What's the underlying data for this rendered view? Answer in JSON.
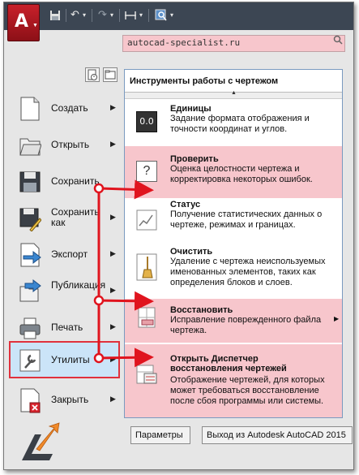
{
  "search": {
    "value": "autocad-specialist.ru"
  },
  "menu": {
    "items": [
      {
        "label": "Создать",
        "has_arrow": true
      },
      {
        "label": "Открыть",
        "has_arrow": true
      },
      {
        "label": "Сохранить",
        "has_arrow": false
      },
      {
        "label": "Сохранить как",
        "has_arrow": true
      },
      {
        "label": "Экспорт",
        "has_arrow": true
      },
      {
        "label": "Публикация",
        "has_arrow": true
      },
      {
        "label": "Печать",
        "has_arrow": true
      },
      {
        "label": "Утилиты",
        "has_arrow": true,
        "selected": true
      },
      {
        "label": "Закрыть",
        "has_arrow": true
      }
    ]
  },
  "panel": {
    "title": "Инструменты работы с чертежом",
    "items": [
      {
        "title": "Единицы",
        "desc": "Задание формата отображения и точности координат и углов.",
        "highlighted": false,
        "icon": "units-icon",
        "icon_text": "0.0"
      },
      {
        "title": "Проверить",
        "desc": "Оценка целостности чертежа и корректировка некоторых ошибок.",
        "highlighted": true,
        "icon": "audit-icon",
        "icon_text": "?"
      },
      {
        "title": "Статус",
        "desc": "Получение статистических данных о чертеже, режимах и границах.",
        "highlighted": false,
        "icon": "status-icon"
      },
      {
        "title": "Очистить",
        "desc": "Удаление с чертежа неиспользуемых именованных элементов, таких как определения блоков и слоев.",
        "highlighted": false,
        "icon": "purge-broom-icon"
      },
      {
        "title": "Восстановить",
        "desc": "Исправление поврежденного файла чертежа.",
        "highlighted": true,
        "icon": "recover-icon",
        "has_arrow": true
      },
      {
        "title": "Открыть Диспетчер восстановления чертежей",
        "desc": "Отображение чертежей, для которых может требоваться восстановление после сбоя программы или системы.",
        "highlighted": true,
        "icon": "drawing-recovery-icon"
      }
    ]
  },
  "buttons": {
    "options": "Параметры",
    "exit": "Выход из Autodesk AutoCAD 2015"
  },
  "colors": {
    "highlight": "#f7c6cc",
    "annotation_red": "#e0141e",
    "selected_bg": "#cbe4f8",
    "titlebar": "#3c4653"
  }
}
